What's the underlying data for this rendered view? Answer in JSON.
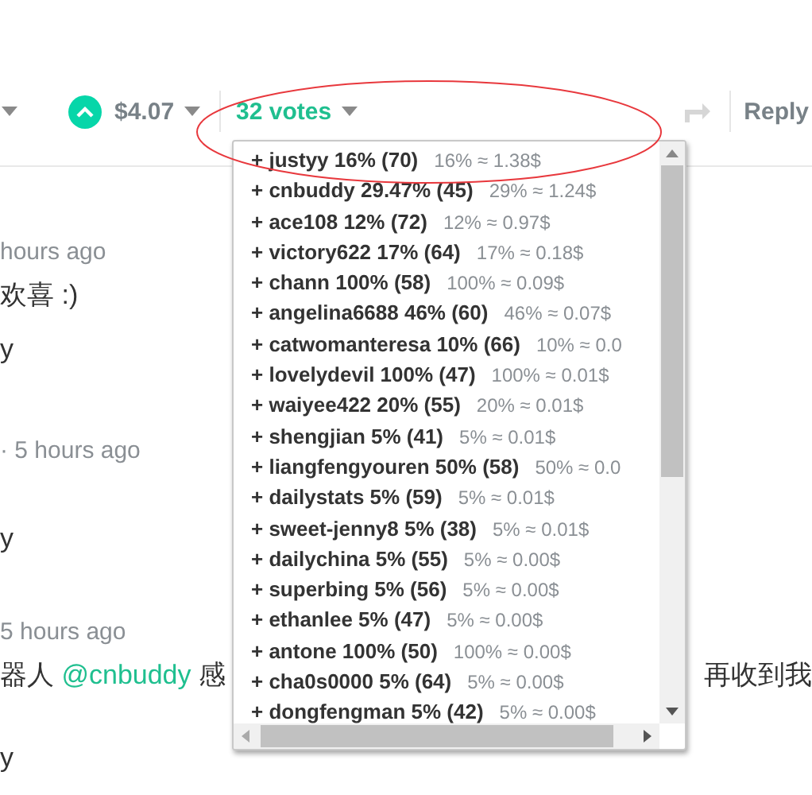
{
  "toolbar": {
    "payout": "$4.07",
    "votes": "32 votes",
    "reply": "Reply"
  },
  "votes_popup": {
    "rows": [
      {
        "voter": "+ justyy 16% (70)",
        "share": "16% ≈ 1.38$"
      },
      {
        "voter": "+ cnbuddy 29.47% (45)",
        "share": "29% ≈ 1.24$"
      },
      {
        "voter": "+ ace108 12% (72)",
        "share": "12% ≈ 0.97$"
      },
      {
        "voter": "+ victory622 17% (64)",
        "share": "17% ≈ 0.18$"
      },
      {
        "voter": "+ chann 100% (58)",
        "share": "100% ≈ 0.09$"
      },
      {
        "voter": "+ angelina6688 46% (60)",
        "share": "46% ≈ 0.07$"
      },
      {
        "voter": "+ catwomanteresa 10% (66)",
        "share": "10% ≈ 0.0"
      },
      {
        "voter": "+ lovelydevil 100% (47)",
        "share": "100% ≈ 0.01$"
      },
      {
        "voter": "+ waiyee422 20% (55)",
        "share": "20% ≈ 0.01$"
      },
      {
        "voter": "+ shengjian 5% (41)",
        "share": "5% ≈ 0.01$"
      },
      {
        "voter": "+ liangfengyouren 50% (58)",
        "share": "50% ≈ 0.0"
      },
      {
        "voter": "+ dailystats 5% (59)",
        "share": "5% ≈ 0.01$"
      },
      {
        "voter": "+ sweet-jenny8 5% (38)",
        "share": "5% ≈ 0.01$"
      },
      {
        "voter": "+ dailychina 5% (55)",
        "share": "5% ≈ 0.00$"
      },
      {
        "voter": "+ superbing 5% (56)",
        "share": "5% ≈ 0.00$"
      },
      {
        "voter": "+ ethanlee 5% (47)",
        "share": "5% ≈ 0.00$"
      },
      {
        "voter": "+ antone 100% (50)",
        "share": "100% ≈ 0.00$"
      },
      {
        "voter": "+ cha0s0000 5% (64)",
        "share": "5% ≈ 0.00$"
      },
      {
        "voter": "+ dongfengman 5% (42)",
        "share": "5% ≈ 0.00$"
      }
    ]
  },
  "comments": [
    {
      "time": "hours ago",
      "body": [
        {
          "kind": "text",
          "text": "欢喜 :)"
        }
      ],
      "author": "y"
    },
    {
      "time": "· 5 hours ago",
      "author": "y"
    },
    {
      "time": "5 hours ago",
      "body": [
        {
          "kind": "text",
          "text": "器人 "
        },
        {
          "kind": "link",
          "text": "@cnbuddy"
        },
        {
          "kind": "text",
          "text": " 感"
        }
      ],
      "body_right": "再收到我",
      "author": "y"
    }
  ]
}
